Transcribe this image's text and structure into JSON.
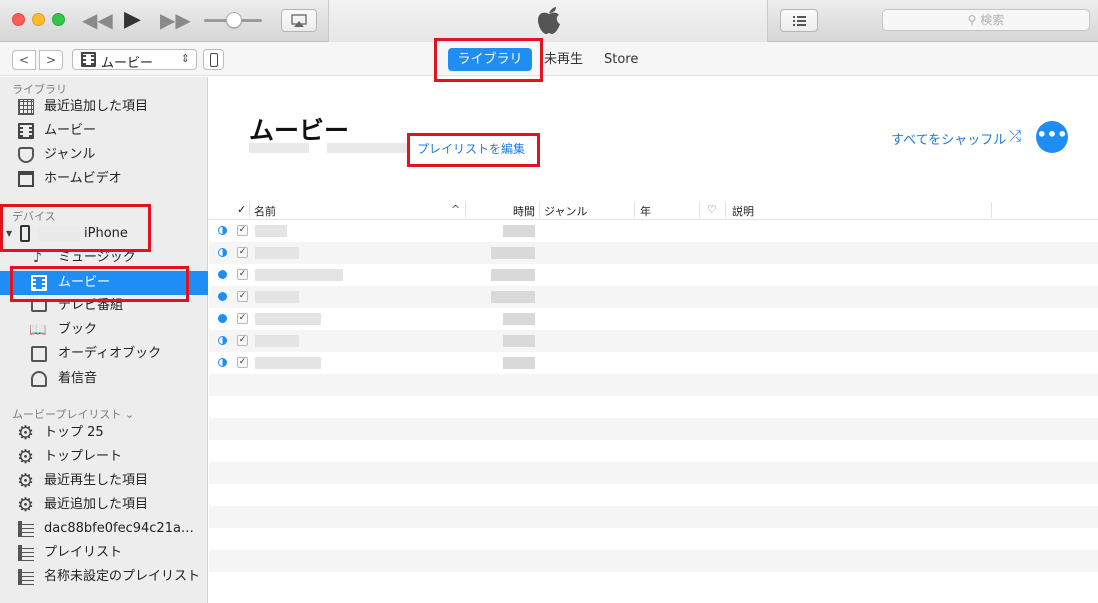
{
  "toolbar": {
    "search_placeholder": "検索"
  },
  "navbar": {
    "back": "<",
    "forward": ">",
    "media_kind": "ムービー",
    "tabs": [
      {
        "label": "ライブラリ",
        "active": true
      },
      {
        "label": "未再生",
        "active": false
      },
      {
        "label": "Store",
        "active": false
      }
    ]
  },
  "sidebar": {
    "library_title": "ライブラリ",
    "library_items": [
      {
        "label": "最近追加した項目",
        "icon": "grid-icon"
      },
      {
        "label": "ムービー",
        "icon": "film-icon"
      },
      {
        "label": "ジャンル",
        "icon": "mask-icon"
      },
      {
        "label": "ホームビデオ",
        "icon": "house-icon"
      }
    ],
    "devices_title": "デバイス",
    "device_name": "iPhone",
    "device_items": [
      {
        "label": "ミュージック",
        "icon": "music-note-icon"
      },
      {
        "label": "ムービー",
        "icon": "film-icon",
        "selected": true
      },
      {
        "label": "テレビ番組",
        "icon": "tv-icon"
      },
      {
        "label": "ブック",
        "icon": "book-icon"
      },
      {
        "label": "オーディオブック",
        "icon": "audiobook-icon"
      },
      {
        "label": "着信音",
        "icon": "bell-icon"
      }
    ],
    "playlists_title": "ムービープレイリスト",
    "playlist_items": [
      {
        "label": "トップ 25",
        "icon": "gear-icon"
      },
      {
        "label": "トップレート",
        "icon": "gear-icon"
      },
      {
        "label": "最近再生した項目",
        "icon": "gear-icon"
      },
      {
        "label": "最近追加した項目",
        "icon": "gear-icon"
      },
      {
        "label": "dac88bfe0fec94c21a…",
        "icon": "playlist-icon"
      },
      {
        "label": "プレイリスト",
        "icon": "playlist-icon"
      },
      {
        "label": "名称未設定のプレイリスト",
        "icon": "playlist-icon"
      }
    ]
  },
  "main": {
    "title": "ムービー",
    "edit_playlist": "プレイリストを編集",
    "shuffle_all": "すべてをシャッフル",
    "more": "•••",
    "columns": {
      "check": "✓",
      "name": "名前",
      "time": "時間",
      "genre": "ジャンル",
      "year": "年",
      "love": "♡",
      "description": "説明"
    },
    "rows": [
      {
        "status": "half",
        "checked": true
      },
      {
        "status": "half",
        "checked": true
      },
      {
        "status": "full",
        "checked": true
      },
      {
        "status": "full",
        "checked": true
      },
      {
        "status": "full",
        "checked": true
      },
      {
        "status": "half",
        "checked": true
      },
      {
        "status": "half",
        "checked": true
      }
    ]
  },
  "colors": {
    "accent": "#1e8ef4",
    "highlight": "#e0141e",
    "link": "#1e7be0"
  }
}
